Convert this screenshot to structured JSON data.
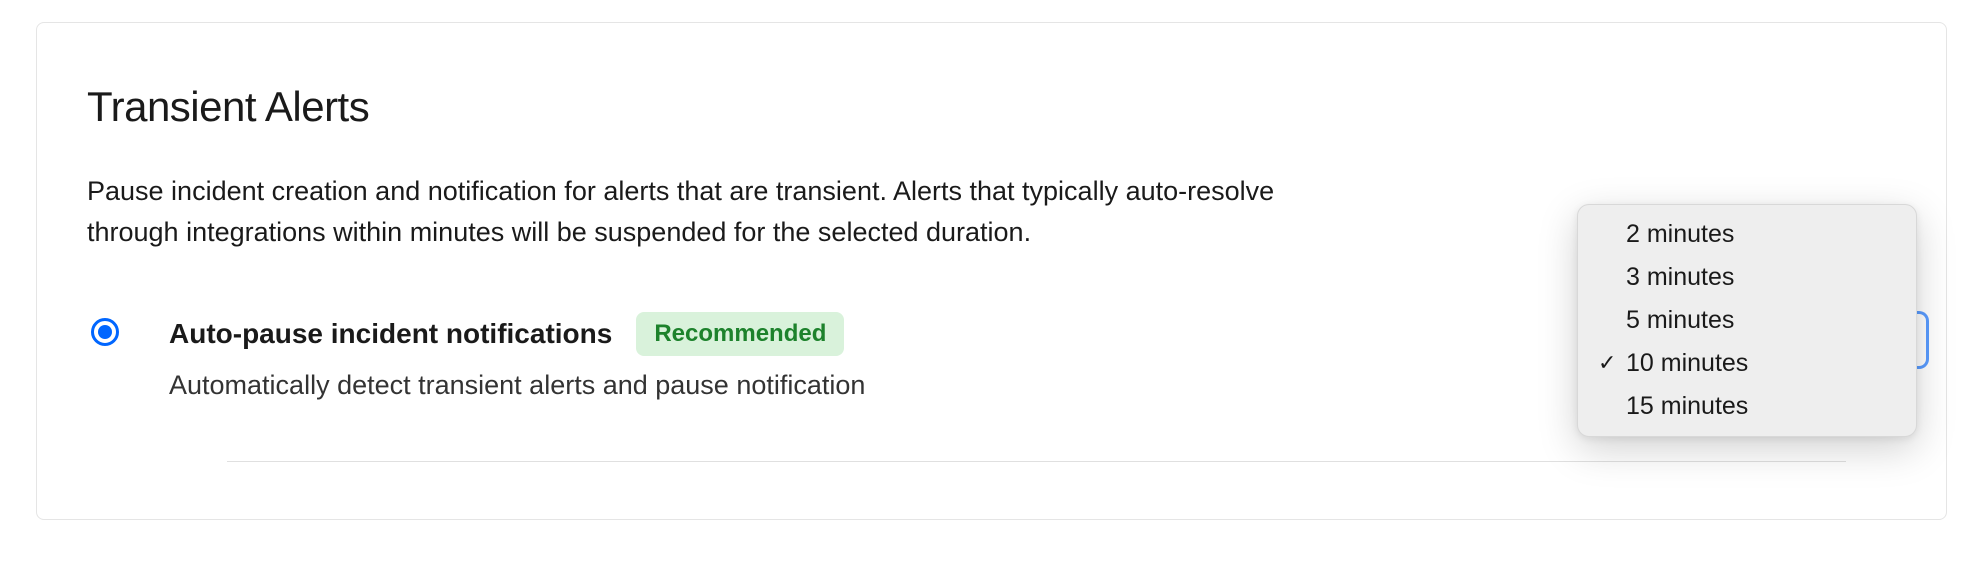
{
  "section": {
    "title": "Transient Alerts",
    "description": "Pause incident creation and notification for alerts that are transient.  Alerts that typically auto-resolve through integrations within minutes will be suspended for the selected duration."
  },
  "option": {
    "label": "Auto-pause incident notifications",
    "badge": "Recommended",
    "subtext": "Automatically detect transient alerts and pause notification"
  },
  "dropdown": {
    "items": [
      {
        "label": "2 minutes",
        "selected": false
      },
      {
        "label": "3 minutes",
        "selected": false
      },
      {
        "label": "5 minutes",
        "selected": false
      },
      {
        "label": "10 minutes",
        "selected": true
      },
      {
        "label": "15 minutes",
        "selected": false
      }
    ]
  }
}
